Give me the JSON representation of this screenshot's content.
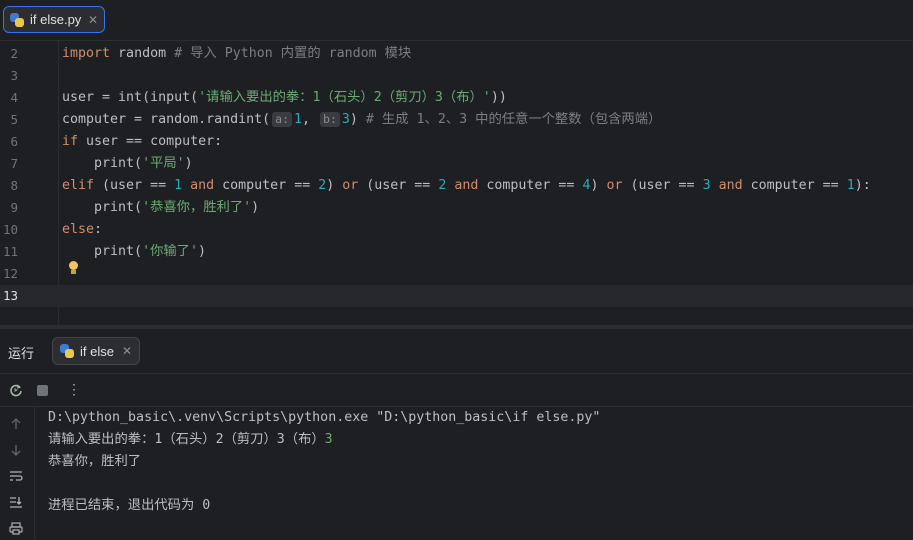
{
  "editor_tab": {
    "filename": "if else.py",
    "close": "✕",
    "icon": "python-file-icon"
  },
  "editor": {
    "lines": [
      {
        "n": "2",
        "segments": [
          {
            "t": "import",
            "c": "kw"
          },
          {
            "t": " random ",
            "c": "fn"
          },
          {
            "t": "# 导入 Python 内置的 random 模块",
            "c": "cmt"
          }
        ]
      },
      {
        "n": "3",
        "segments": []
      },
      {
        "n": "4",
        "segments": [
          {
            "t": "user = ",
            "c": "fn"
          },
          {
            "t": "int",
            "c": "fn"
          },
          {
            "t": "(",
            "c": "fn"
          },
          {
            "t": "input",
            "c": "fn"
          },
          {
            "t": "(",
            "c": "fn"
          },
          {
            "t": "'请输入要出的拳：1（石头）2（剪刀）3（布）'",
            "c": "str"
          },
          {
            "t": "))",
            "c": "fn"
          }
        ]
      },
      {
        "n": "5",
        "segments": [
          {
            "t": "computer = random.randint(",
            "c": "fn"
          },
          {
            "t": "a:",
            "c": "hint"
          },
          {
            "t": "1",
            "c": "num"
          },
          {
            "t": ", ",
            "c": "fn"
          },
          {
            "t": "b:",
            "c": "hint"
          },
          {
            "t": "3",
            "c": "num"
          },
          {
            "t": ") ",
            "c": "fn"
          },
          {
            "t": "# 生成 1、2、3 中的任意一个整数（包含两端）",
            "c": "cmt"
          }
        ]
      },
      {
        "n": "6",
        "segments": [
          {
            "t": "if",
            "c": "kw"
          },
          {
            "t": " user == computer:",
            "c": "fn"
          }
        ]
      },
      {
        "n": "7",
        "segments": [
          {
            "t": "    print(",
            "c": "fn"
          },
          {
            "t": "'平局'",
            "c": "str"
          },
          {
            "t": ")",
            "c": "fn"
          }
        ]
      },
      {
        "n": "8",
        "segments": [
          {
            "t": "elif",
            "c": "kw"
          },
          {
            "t": " (user == ",
            "c": "fn"
          },
          {
            "t": "1",
            "c": "num"
          },
          {
            "t": " and",
            "c": "kw"
          },
          {
            "t": " computer == ",
            "c": "fn"
          },
          {
            "t": "2",
            "c": "num"
          },
          {
            "t": ") ",
            "c": "fn"
          },
          {
            "t": "or",
            "c": "kw"
          },
          {
            "t": " (user == ",
            "c": "fn"
          },
          {
            "t": "2",
            "c": "num"
          },
          {
            "t": " and",
            "c": "kw"
          },
          {
            "t": " computer == ",
            "c": "fn"
          },
          {
            "t": "4",
            "c": "num"
          },
          {
            "t": ") ",
            "c": "fn"
          },
          {
            "t": "or",
            "c": "kw"
          },
          {
            "t": " (user == ",
            "c": "fn"
          },
          {
            "t": "3",
            "c": "num"
          },
          {
            "t": " and",
            "c": "kw"
          },
          {
            "t": " computer == ",
            "c": "fn"
          },
          {
            "t": "1",
            "c": "num"
          },
          {
            "t": "):",
            "c": "fn"
          }
        ]
      },
      {
        "n": "9",
        "segments": [
          {
            "t": "    print(",
            "c": "fn"
          },
          {
            "t": "'恭喜你，胜利了'",
            "c": "str"
          },
          {
            "t": ")",
            "c": "fn"
          }
        ]
      },
      {
        "n": "10",
        "segments": [
          {
            "t": "else",
            "c": "kw"
          },
          {
            "t": ":",
            "c": "fn"
          }
        ]
      },
      {
        "n": "11",
        "segments": [
          {
            "t": "    print(",
            "c": "fn"
          },
          {
            "t": "'你输了'",
            "c": "str"
          },
          {
            "t": ")",
            "c": "fn"
          }
        ]
      },
      {
        "n": "12",
        "segments": []
      },
      {
        "n": "13",
        "segments": [],
        "current": true
      }
    ]
  },
  "run_panel": {
    "label": "运行",
    "tab_name": "if else",
    "tab_close": "✕",
    "toolbar": {
      "rerun_icon": "rerun-icon",
      "stop_icon": "stop-icon",
      "more_label": "⋮"
    }
  },
  "console": {
    "command": "D:\\python_basic\\.venv\\Scripts\\python.exe \"D:\\python_basic\\if else.py\"",
    "prompt": "请输入要出的拳：1（石头）2（剪刀）3（布）",
    "user_input": "3",
    "result": "恭喜你，胜利了",
    "exit_message": "进程已结束，退出代码为 0",
    "sidebar_icons": [
      "arrow-up-icon",
      "arrow-down-icon",
      "soft-wrap-icon",
      "scroll-to-end-icon",
      "print-icon"
    ]
  },
  "colors": {
    "keyword": "#cf8e6d",
    "number": "#2aacb8",
    "string": "#6aab73",
    "comment": "#7a7e85",
    "accent": "#3574f0"
  }
}
